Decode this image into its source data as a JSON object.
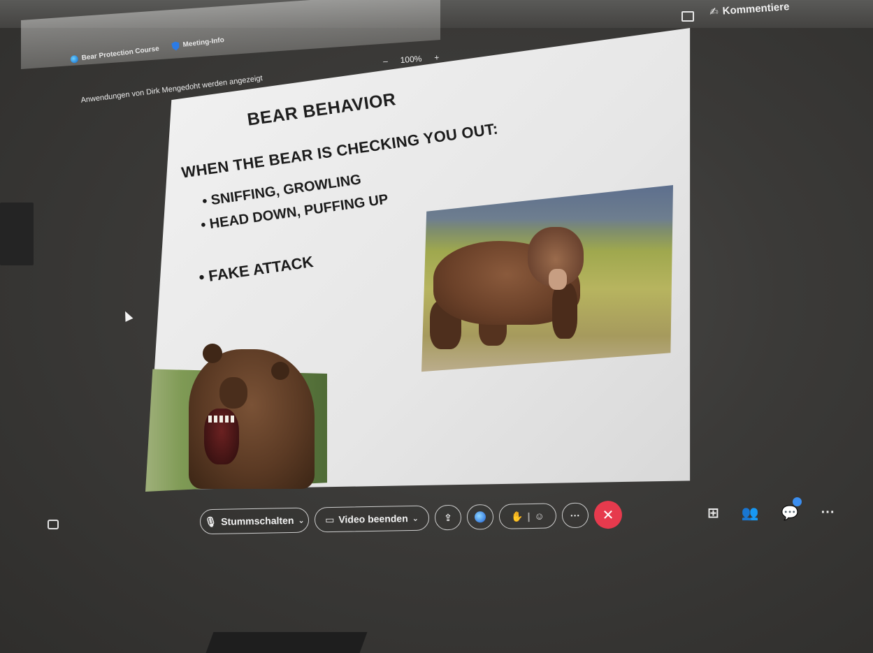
{
  "meeting": {
    "course_title": "Bear Protection Course",
    "info_label": "Meeting-Info",
    "sharing_notice": "Anwendungen von Dirk Mengedoht werden angezeigt",
    "zoom_minus": "–",
    "zoom_level": "100%",
    "zoom_plus": "+",
    "comments_label": "Kommentiere",
    "comments_glyph": "✍"
  },
  "slide": {
    "title": "BEAR BEHAVIOR",
    "heading": "WHEN THE BEAR IS CHECKING YOU OUT:",
    "bullets": [
      "SNIFFING, GROWLING",
      "HEAD DOWN, PUFFING UP",
      "FAKE ATTACK"
    ]
  },
  "toolbar": {
    "mute_glyph": "🎙",
    "mute_label": "Stummschalten",
    "chevron": "⌄",
    "video_glyph": "▭",
    "video_label": "Video beenden",
    "share_glyph": "⇪",
    "hand_glyph": "✋",
    "react_glyph": "☺",
    "more_glyph": "···",
    "end_glyph": "✕"
  },
  "right_tools": {
    "apps_glyph": "⊞",
    "participants_glyph": "👥",
    "chat_glyph": "💬",
    "more_glyph": "···"
  },
  "colors": {
    "end_call": "#e63a4d",
    "notification": "#3b8ef0",
    "accent": "#1c5ed6"
  }
}
